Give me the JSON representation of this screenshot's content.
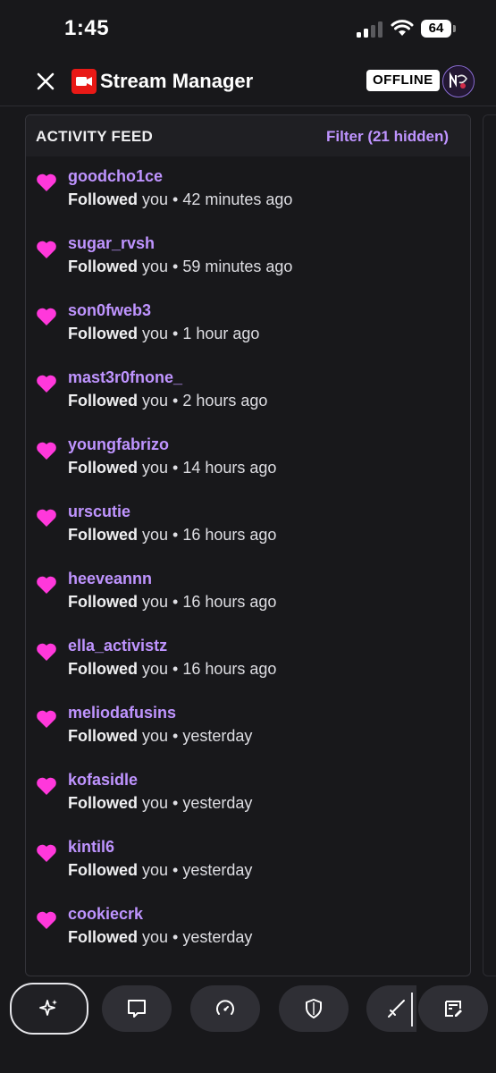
{
  "status_bar": {
    "time": "1:45",
    "battery": "64"
  },
  "header": {
    "title": "Stream Manager",
    "status_badge": "OFFLINE"
  },
  "activity_feed": {
    "title": "ACTIVITY FEED",
    "filter_label": "Filter (21 hidden)",
    "items": [
      {
        "user": "goodcho1ce",
        "action": "Followed",
        "rest": " you • 42 minutes ago"
      },
      {
        "user": "sugar_rvsh",
        "action": "Followed",
        "rest": " you • 59 minutes ago"
      },
      {
        "user": "son0fweb3",
        "action": "Followed",
        "rest": " you • 1 hour ago"
      },
      {
        "user": "mast3r0fnone_",
        "action": "Followed",
        "rest": " you • 2 hours ago"
      },
      {
        "user": "youngfabrizo",
        "action": "Followed",
        "rest": " you • 14 hours ago"
      },
      {
        "user": "urscutie",
        "action": "Followed",
        "rest": " you • 16 hours ago"
      },
      {
        "user": "heeveannn",
        "action": "Followed",
        "rest": " you • 16 hours ago"
      },
      {
        "user": "ella_activistz",
        "action": "Followed",
        "rest": " you • 16 hours ago"
      },
      {
        "user": "meliodafusins",
        "action": "Followed",
        "rest": " you • yesterday"
      },
      {
        "user": "kofasidle",
        "action": "Followed",
        "rest": " you • yesterday"
      },
      {
        "user": "kintil6",
        "action": "Followed",
        "rest": " you • yesterday"
      },
      {
        "user": "cookiecrk",
        "action": "Followed",
        "rest": " you • yesterday"
      }
    ]
  },
  "toolbar": {
    "buttons": [
      {
        "icon": "sparkle-icon",
        "active": true
      },
      {
        "icon": "chat-icon",
        "active": false
      },
      {
        "icon": "speedometer-icon",
        "active": false
      },
      {
        "icon": "shield-icon",
        "active": false
      },
      {
        "icon": "sword-icon",
        "active": false
      },
      {
        "icon": "edit-board-icon",
        "active": false
      }
    ]
  },
  "colors": {
    "accent": "#bf94ff",
    "heart": "#ff38db",
    "background": "#18181b",
    "logo_red": "#e91916"
  }
}
